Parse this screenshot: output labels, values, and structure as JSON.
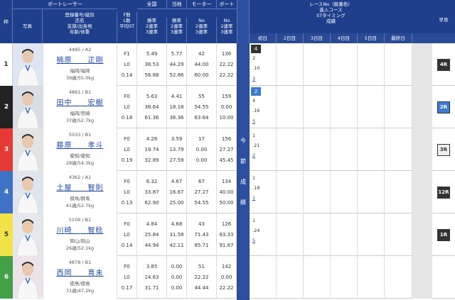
{
  "header": {
    "waku": "枠",
    "photo": "写真",
    "boat_racer": "ボートレーサー",
    "info_lines": [
      "登録番号/級別",
      "氏名",
      "支部/出身地",
      "年齢/体重"
    ],
    "stats_group": [
      "全国",
      "当地",
      "モーター",
      "ボート"
    ],
    "stat_cols": [
      [
        "F数",
        "L数",
        "平均ST"
      ],
      [
        "勝率",
        "2連率",
        "3連率"
      ],
      [
        "勝率",
        "2連率",
        "3連率"
      ],
      [
        "No",
        "2連率",
        "3連率"
      ],
      [
        "No",
        "2連率",
        "3連率"
      ]
    ],
    "race_info": [
      "レースNo（艇番色）",
      "進入コース",
      "STタイミング",
      "成績"
    ],
    "days": [
      "初日",
      "2日目",
      "3日目",
      "4日目",
      "5日目",
      "最終日"
    ],
    "yoso": "早見"
  },
  "konsetsu": [
    "今",
    "節",
    "成",
    "績"
  ],
  "racers": [
    {
      "waku": "1",
      "waku_color": "#ffffff",
      "waku_text": "#333333",
      "reg": "4485 / A2",
      "name": "楠原　　正剛",
      "branch": "福岡/福岡",
      "age": "39歳/55.0kg",
      "f": "F1",
      "l": "L0",
      "st": "0.14",
      "nat": [
        "5.49",
        "38.53",
        "56.88"
      ],
      "loc": [
        "5.77",
        "44.29",
        "52.86"
      ],
      "mot": [
        "42",
        "44.00",
        "60.00"
      ],
      "boat": [
        "136",
        "22.22",
        "22.22"
      ],
      "course": "4",
      "course_color": "#333333",
      "g": [
        "2",
        ".10",
        "3"
      ],
      "badge": "4R",
      "badge_bg": "#333333",
      "badge_fg": "#ffffff"
    },
    {
      "waku": "2",
      "waku_color": "#222222",
      "waku_text": "#ffffff",
      "reg": "4861 / B1",
      "name": "田中　　宏樹",
      "branch": "福岡/宮崎",
      "age": "37歳/52.7kg",
      "f": "F0",
      "l": "L0",
      "st": "0.18",
      "nat": [
        "5.63",
        "38.64",
        "61.36"
      ],
      "loc": [
        "4.41",
        "18.18",
        "36.36"
      ],
      "mot": [
        "55",
        "54.55",
        "63.64"
      ],
      "boat": [
        "159",
        "0.00",
        "10.00"
      ],
      "course": "2",
      "course_color": "#3b7bd0",
      "g": [
        "4",
        ".16",
        "5"
      ],
      "badge": "2R",
      "badge_bg": "#3b7bd0",
      "badge_fg": "#ffffff"
    },
    {
      "waku": "3",
      "waku_color": "#e53935",
      "waku_text": "#ffffff",
      "reg": "5033 / B1",
      "name": "藤原　　孝斗",
      "branch": "愛知/愛知",
      "age": "28歳/54.3kg",
      "f": "F0",
      "l": "L0",
      "st": "0.19",
      "nat": [
        "4.26",
        "19.74",
        "32.89"
      ],
      "loc": [
        "3.59",
        "13.79",
        "27.59"
      ],
      "mot": [
        "17",
        "0.00",
        "0.00"
      ],
      "boat": [
        "156",
        "27.27",
        "45.45"
      ],
      "course": "",
      "course_color": "#ffffff",
      "g": [
        "1",
        ".21",
        "2"
      ],
      "badge": "3R",
      "badge_bg": "#eeeeee",
      "badge_fg": "#333333"
    },
    {
      "waku": "4",
      "waku_color": "#3f72c4",
      "waku_text": "#ffffff",
      "reg": "4362 / A1",
      "name": "土屋　　智則",
      "branch": "群馬/群馬",
      "age": "41歳/52.7kg",
      "f": "F0",
      "l": "L0",
      "st": "0.13",
      "nat": [
        "6.32",
        "33.87",
        "62.90"
      ],
      "loc": [
        "4.67",
        "16.67",
        "25.00"
      ],
      "mot": [
        "67",
        "27.27",
        "54.55"
      ],
      "boat": [
        "134",
        "40.00",
        "50.00"
      ],
      "course": "",
      "course_color": "#ffffff",
      "g": [
        "1",
        ".18",
        "1"
      ],
      "badge": "12R",
      "badge_bg": "#333333",
      "badge_fg": "#ffffff"
    },
    {
      "waku": "5",
      "waku_color": "#f3e34a",
      "waku_text": "#333333",
      "reg": "5109 / B1",
      "name": "川崎　　智稔",
      "branch": "岡山/岡山",
      "age": "26歳/52.1kg",
      "f": "F0",
      "l": "L0",
      "st": "0.14",
      "nat": [
        "4.84",
        "25.84",
        "44.94"
      ],
      "loc": [
        "4.68",
        "31.58",
        "42.11"
      ],
      "mot": [
        "43",
        "71.43",
        "85.71"
      ],
      "boat": [
        "126",
        "83.33",
        "91.67"
      ],
      "course": "",
      "course_color": "#ffffff",
      "g": [
        "1",
        ".24",
        "5"
      ],
      "badge": "1R",
      "badge_bg": "#333333",
      "badge_fg": "#ffffff"
    },
    {
      "waku": "6",
      "waku_color": "#43a047",
      "waku_text": "#ffffff",
      "reg": "4878 / B1",
      "name": "西岡　　育未",
      "branch": "徳島/徳島",
      "age": "31歳/47.2kg",
      "f": "F0",
      "l": "L0",
      "st": "0.17",
      "nat": [
        "3.85",
        "14.63",
        "31.71"
      ],
      "loc": [
        "0.00",
        "0.00",
        "0.00"
      ],
      "mot": [
        "51",
        "22.22",
        "44.44"
      ],
      "boat": [
        "142",
        "0.00",
        "22.22"
      ],
      "course": "",
      "course_color": "#ffffff",
      "g": [
        "",
        "",
        ""
      ],
      "badge": "",
      "badge_bg": "",
      "badge_fg": ""
    }
  ]
}
